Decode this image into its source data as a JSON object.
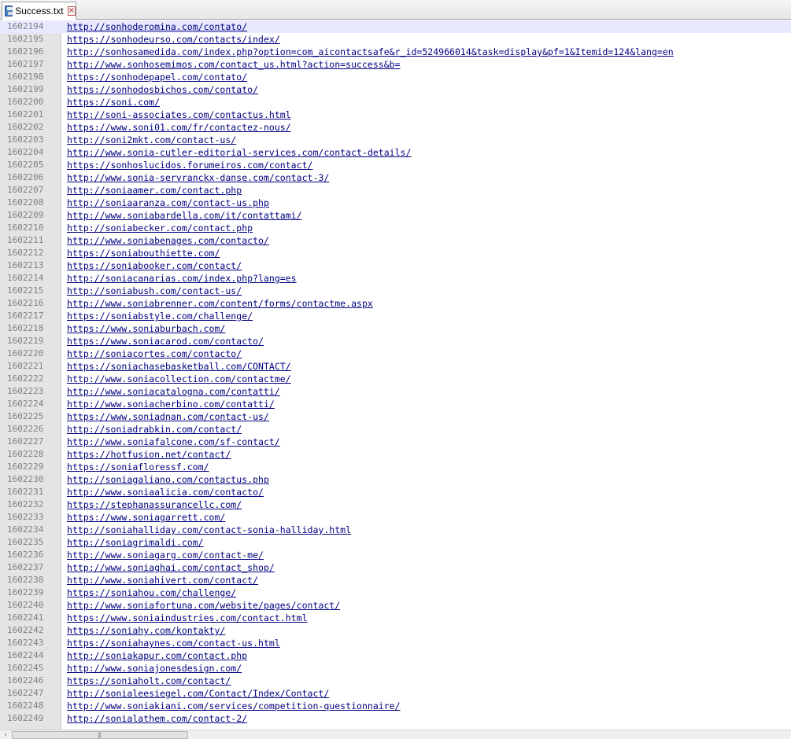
{
  "tab": {
    "title": "Success.txt",
    "icon": "save-icon",
    "close_icon": "close-icon"
  },
  "colors": {
    "gutter": "#e4e4e4",
    "current_line": "#e8e8ff",
    "link": "#000080",
    "line_number": "#808080"
  },
  "lines": [
    {
      "number": "1602194",
      "text": "http://sonhoderomina.com/contato/"
    },
    {
      "number": "1602195",
      "text": "https://sonhodeurso.com/contacts/index/"
    },
    {
      "number": "1602196",
      "text": "http://sonhosamedida.com/index.php?option=com_aicontactsafe&r_id=524966014&task=display&pf=1&Itemid=124&lang=en"
    },
    {
      "number": "1602197",
      "text": "http://www.sonhosemimos.com/contact_us.html?action=success&b="
    },
    {
      "number": "1602198",
      "text": "https://sonhodepapel.com/contato/"
    },
    {
      "number": "1602199",
      "text": "https://sonhodosbichos.com/contato/"
    },
    {
      "number": "1602200",
      "text": "https://soni.com/"
    },
    {
      "number": "1602201",
      "text": "http://soni-associates.com/contactus.html"
    },
    {
      "number": "1602202",
      "text": "https://www.soni01.com/fr/contactez-nous/"
    },
    {
      "number": "1602203",
      "text": "http://soni2mkt.com/contact-us/"
    },
    {
      "number": "1602204",
      "text": "http://www.sonia-cutler-editorial-services.com/contact-details/"
    },
    {
      "number": "1602205",
      "text": "https://sonhoslucidos.forumeiros.com/contact/"
    },
    {
      "number": "1602206",
      "text": "http://www.sonia-servranckx-danse.com/contact-3/"
    },
    {
      "number": "1602207",
      "text": "http://soniaamer.com/contact.php"
    },
    {
      "number": "1602208",
      "text": "http://soniaaranza.com/contact-us.php"
    },
    {
      "number": "1602209",
      "text": "http://www.soniabardella.com/it/contattami/"
    },
    {
      "number": "1602210",
      "text": "http://soniabecker.com/contact.php"
    },
    {
      "number": "1602211",
      "text": "http://www.soniabenages.com/contacto/"
    },
    {
      "number": "1602212",
      "text": "https://soniabouthiette.com/"
    },
    {
      "number": "1602213",
      "text": "https://soniabooker.com/contact/"
    },
    {
      "number": "1602214",
      "text": "http://soniacanarias.com/index.php?lang=es"
    },
    {
      "number": "1602215",
      "text": "http://soniabush.com/contact-us/"
    },
    {
      "number": "1602216",
      "text": "http://www.soniabrenner.com/content/forms/contactme.aspx"
    },
    {
      "number": "1602217",
      "text": "https://soniabstyle.com/challenge/"
    },
    {
      "number": "1602218",
      "text": "https://www.soniaburbach.com/"
    },
    {
      "number": "1602219",
      "text": "https://www.soniacarod.com/contacto/"
    },
    {
      "number": "1602220",
      "text": "http://soniacortes.com/contacto/"
    },
    {
      "number": "1602221",
      "text": "https://soniachasebasketball.com/CONTACT/"
    },
    {
      "number": "1602222",
      "text": "http://www.soniacollection.com/contactme/"
    },
    {
      "number": "1602223",
      "text": "http://www.soniacatalogna.com/contatti/"
    },
    {
      "number": "1602224",
      "text": "http://www.soniacherbino.com/contatti/"
    },
    {
      "number": "1602225",
      "text": "https://www.soniadnan.com/contact-us/"
    },
    {
      "number": "1602226",
      "text": "http://soniadrabkin.com/contact/"
    },
    {
      "number": "1602227",
      "text": "http://www.soniafalcone.com/sf-contact/"
    },
    {
      "number": "1602228",
      "text": "https://hotfusion.net/contact/"
    },
    {
      "number": "1602229",
      "text": "https://soniafloressf.com/"
    },
    {
      "number": "1602230",
      "text": "http://soniagaliano.com/contactus.php"
    },
    {
      "number": "1602231",
      "text": "http://www.soniaalicia.com/contacto/"
    },
    {
      "number": "1602232",
      "text": "https://stephanassurancellc.com/"
    },
    {
      "number": "1602233",
      "text": "https://www.soniagarrett.com/"
    },
    {
      "number": "1602234",
      "text": "http://soniahalliday.com/contact-sonia-halliday.html"
    },
    {
      "number": "1602235",
      "text": "http://soniagrimaldi.com/"
    },
    {
      "number": "1602236",
      "text": "http://www.soniagarg.com/contact-me/"
    },
    {
      "number": "1602237",
      "text": "http://www.soniaghai.com/contact_shop/"
    },
    {
      "number": "1602238",
      "text": "http://www.soniahivert.com/contact/"
    },
    {
      "number": "1602239",
      "text": "https://soniahou.com/challenge/"
    },
    {
      "number": "1602240",
      "text": "http://www.soniafortuna.com/website/pages/contact/"
    },
    {
      "number": "1602241",
      "text": "https://www.soniaindustries.com/contact.html"
    },
    {
      "number": "1602242",
      "text": "https://soniahy.com/kontakty/"
    },
    {
      "number": "1602243",
      "text": "https://soniahaynes.com/contact-us.html"
    },
    {
      "number": "1602244",
      "text": "http://soniakapur.com/contact.php"
    },
    {
      "number": "1602245",
      "text": "http://www.soniajonesdesign.com/"
    },
    {
      "number": "1602246",
      "text": "https://soniaholt.com/contact/"
    },
    {
      "number": "1602247",
      "text": "http://sonialeesiegel.com/Contact/Index/Contact/"
    },
    {
      "number": "1602248",
      "text": "http://www.soniakiani.com/services/competition-questionnaire/"
    },
    {
      "number": "1602249",
      "text": "http://sonialathem.com/contact-2/"
    }
  ],
  "scrollbar": {
    "left_arrow": "‹",
    "grip": "|||"
  }
}
